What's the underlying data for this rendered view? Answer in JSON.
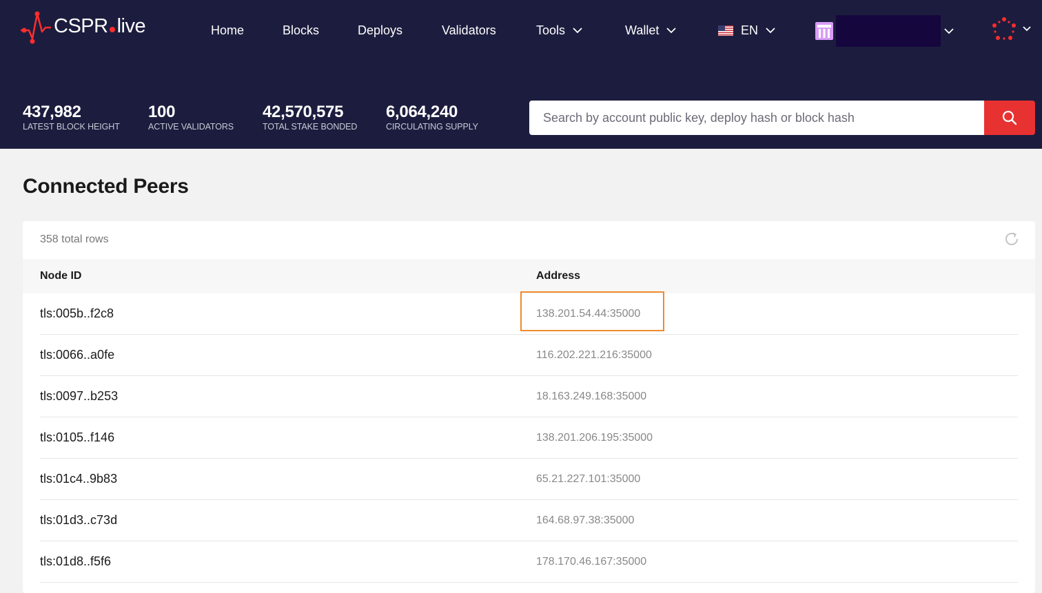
{
  "brand": {
    "name_left": "CSPR",
    "name_right": "live",
    "accent": "#ff2d2d"
  },
  "nav": {
    "home": "Home",
    "blocks": "Blocks",
    "deploys": "Deploys",
    "validators": "Validators",
    "tools": "Tools",
    "wallet": "Wallet",
    "language": "EN"
  },
  "stats": [
    {
      "value": "437,982",
      "label": "LATEST BLOCK HEIGHT"
    },
    {
      "value": "100",
      "label": "ACTIVE VALIDATORS"
    },
    {
      "value": "42,570,575",
      "label": "TOTAL STAKE BONDED"
    },
    {
      "value": "6,064,240",
      "label": "CIRCULATING SUPPLY"
    }
  ],
  "search": {
    "placeholder": "Search by account public key, deploy hash or block hash",
    "value": ""
  },
  "page": {
    "title": "Connected Peers"
  },
  "table": {
    "total_rows": "358 total rows",
    "columns": {
      "node_id": "Node ID",
      "address": "Address"
    },
    "rows": [
      {
        "node_id": "tls:005b..f2c8",
        "address": "138.201.54.44:35000"
      },
      {
        "node_id": "tls:0066..a0fe",
        "address": "116.202.221.216:35000"
      },
      {
        "node_id": "tls:0097..b253",
        "address": "18.163.249.168:35000"
      },
      {
        "node_id": "tls:0105..f146",
        "address": "138.201.206.195:35000"
      },
      {
        "node_id": "tls:01c4..9b83",
        "address": "65.21.227.101:35000"
      },
      {
        "node_id": "tls:01d3..c73d",
        "address": "164.68.97.38:35000"
      },
      {
        "node_id": "tls:01d8..f5f6",
        "address": "178.170.46.167:35000"
      }
    ]
  },
  "colors": {
    "header_bg": "#1c1d3e",
    "search_button": "#e83232",
    "highlight": "#ef8a2e"
  }
}
